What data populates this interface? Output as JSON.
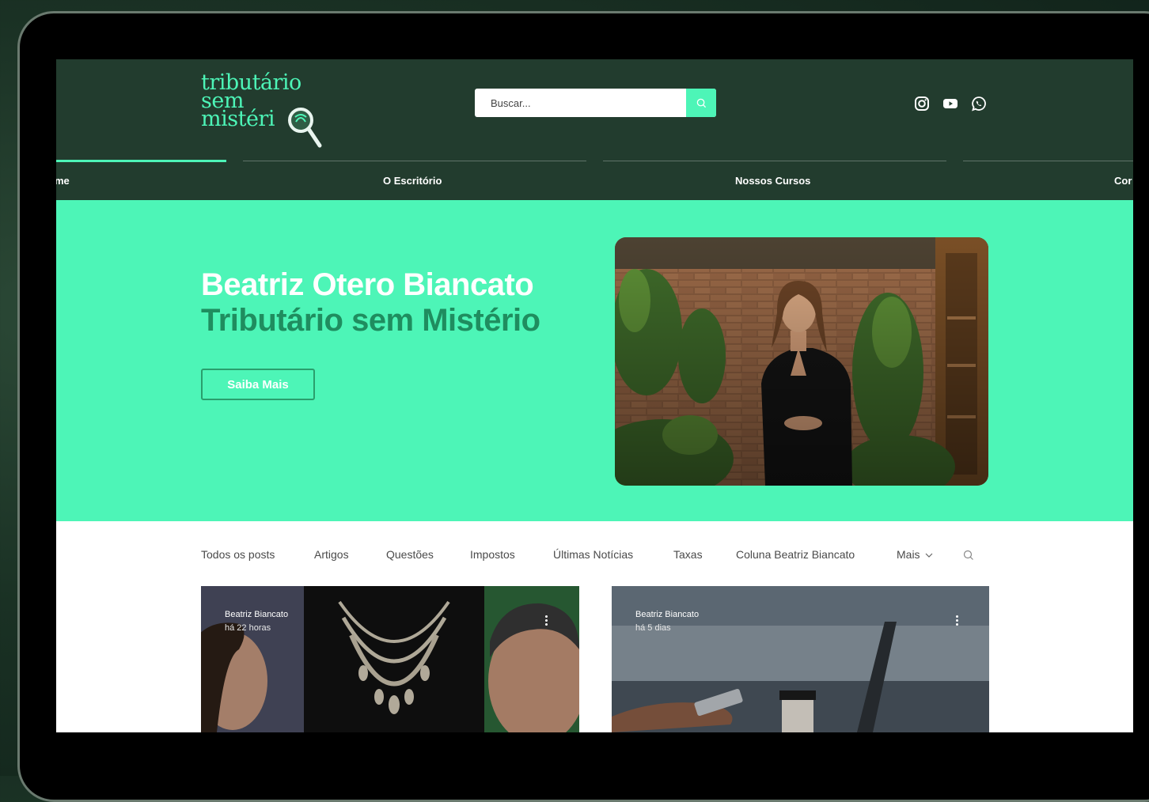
{
  "site": {
    "logo": {
      "line1": "tributário",
      "line2": "sem",
      "line3": "mistéri"
    },
    "search": {
      "placeholder": "Buscar..."
    },
    "social": [
      "instagram-icon",
      "youtube-icon",
      "whatsapp-icon"
    ]
  },
  "nav": {
    "items": [
      {
        "label": "me"
      },
      {
        "label": "O Escritório"
      },
      {
        "label": "Nossos Cursos"
      },
      {
        "label": "Cor"
      }
    ]
  },
  "hero": {
    "title": "Beatriz Otero Biancato",
    "subtitle": "Tributário sem Mistério",
    "button": "Saiba Mais"
  },
  "blog": {
    "categories": [
      "Todos os posts",
      "Artigos",
      "Questões",
      "Impostos",
      "Últimas Notícias",
      "Taxas",
      "Coluna Beatriz Biancato",
      "Mais"
    ],
    "posts": [
      {
        "author": "Beatriz Biancato",
        "time": "há 22 horas"
      },
      {
        "author": "Beatriz Biancato",
        "time": "há 5 dias"
      }
    ]
  },
  "colors": {
    "accent": "#4df5b7",
    "header_bg": "#223c2e",
    "hero_sub": "#1f8d5f",
    "outer_bg": "#1a3124"
  }
}
